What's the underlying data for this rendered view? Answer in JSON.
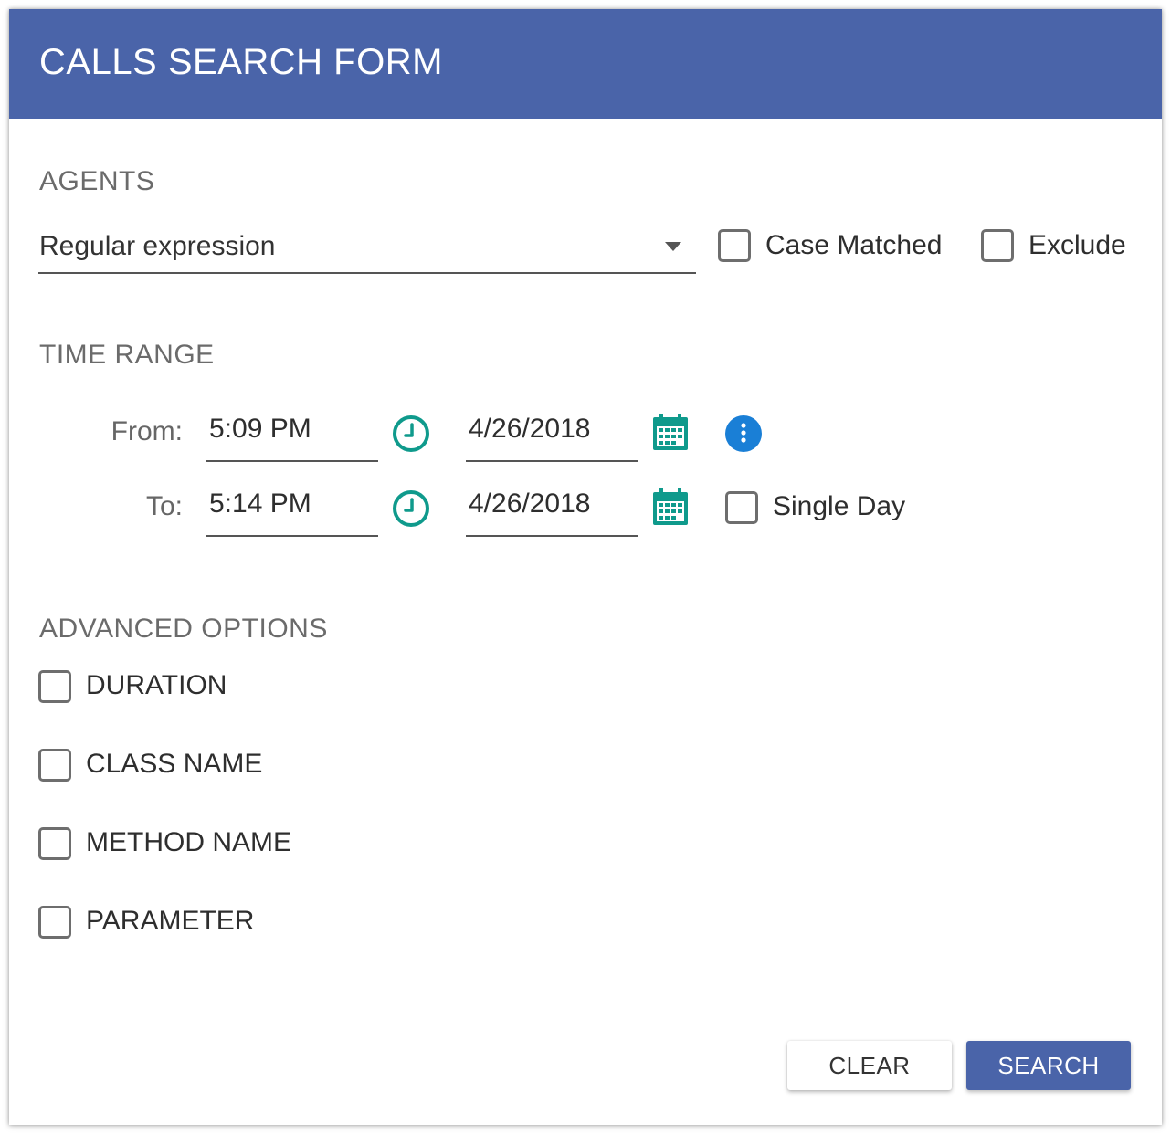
{
  "header": {
    "title": "CALLS SEARCH FORM"
  },
  "agents": {
    "section_title": "AGENTS",
    "select_value": "Regular expression",
    "case_matched_label": "Case Matched",
    "exclude_label": "Exclude"
  },
  "time_range": {
    "section_title": "TIME RANGE",
    "from_label": "From:",
    "from_time": "5:09 PM",
    "from_date": "4/26/2018",
    "to_label": "To:",
    "to_time": "5:14 PM",
    "to_date": "4/26/2018",
    "single_day_label": "Single Day"
  },
  "advanced": {
    "section_title": "ADVANCED OPTIONS",
    "options": [
      "DURATION",
      "CLASS NAME",
      "METHOD NAME",
      "PARAMETER"
    ]
  },
  "actions": {
    "clear_label": "CLEAR",
    "search_label": "SEARCH"
  },
  "colors": {
    "header": "#4a64a9",
    "accent_teal": "#0f9a8c",
    "info_blue": "#1a7fd6",
    "primary_button": "#4a64a9"
  },
  "icons": {
    "time": "clock-icon",
    "date": "calendar-icon",
    "info": "info-icon",
    "dropdown": "chevron-down-icon"
  }
}
